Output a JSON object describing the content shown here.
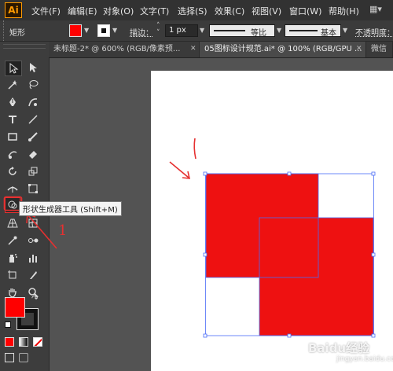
{
  "app": {
    "logo_text": "Ai"
  },
  "menu": [
    "文件(F)",
    "编辑(E)",
    "对象(O)",
    "文字(T)",
    "选择(S)",
    "效果(C)",
    "视图(V)",
    "窗口(W)",
    "帮助(H)"
  ],
  "control_bar": {
    "object_type": "矩形",
    "fill_color": "#ff0000",
    "stroke_label": "描边：",
    "stroke_value": "1 px",
    "profile_label": "等比",
    "brush_label": "基本",
    "opacity_label": "不透明度："
  },
  "tabs": [
    "未标题-2* @ 600% (RGB/像素预...",
    "05图标设计规范.ai* @ 100% (RGB/GPU ...",
    "微信"
  ],
  "tooltip": "形状生成器工具 (Shift+M)",
  "annotations": {
    "step_number": "1"
  },
  "colors": {
    "fill": "#ff0000",
    "shape_red": "#ee1111",
    "selection": "#4a6cf7",
    "annotation": "#e63030"
  },
  "watermark": {
    "brand": "Baidu经验",
    "url": "jingyan.baidu.com"
  }
}
